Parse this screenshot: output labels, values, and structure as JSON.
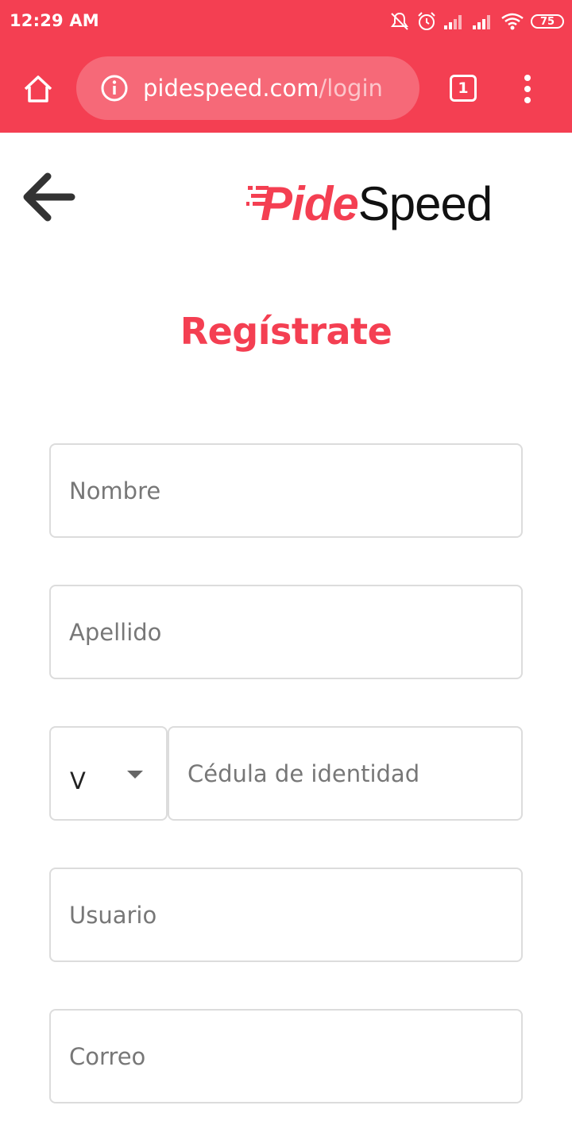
{
  "status_bar": {
    "time": "12:29 AM",
    "battery": "75",
    "icons": [
      "mute-icon",
      "alarm-icon",
      "signal-icon",
      "signal-icon",
      "wifi-icon",
      "battery-icon"
    ]
  },
  "browser": {
    "url_domain": "pidespeed.com",
    "url_path": "/login",
    "tab_count": "1",
    "icons": [
      "home-icon",
      "info-icon",
      "tabs-icon",
      "more-vert-icon"
    ]
  },
  "header": {
    "logo_pide": "Pide",
    "logo_speed": "Speed",
    "back_icon": "arrow-left-icon"
  },
  "page": {
    "title": "Regístrate"
  },
  "form": {
    "nombre_placeholder": "Nombre",
    "apellido_placeholder": "Apellido",
    "id_type_selected": "V",
    "cedula_placeholder": "Cédula de identidad",
    "usuario_placeholder": "Usuario",
    "correo_placeholder": "Correo"
  },
  "colors": {
    "brand": "#f43f52",
    "text_dark": "#111111",
    "border": "#dcdcdc"
  }
}
